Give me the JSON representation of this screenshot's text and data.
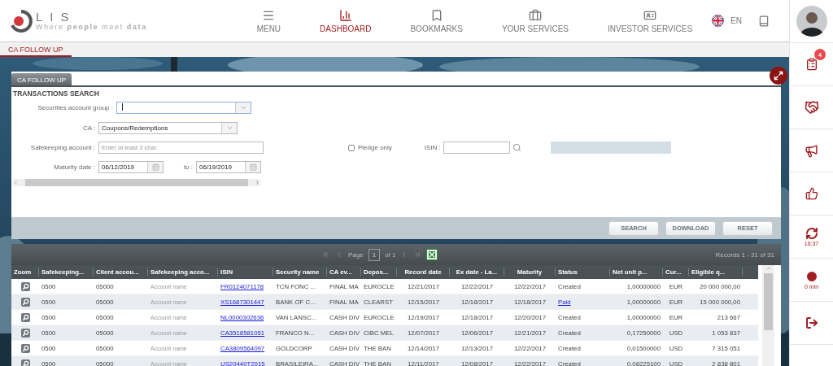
{
  "logo": {
    "name": "LIS",
    "tagline": "Where **people** meet **data**"
  },
  "nav": [
    {
      "label": "MENU",
      "selected": false
    },
    {
      "label": "DASHBOARD",
      "selected": true
    },
    {
      "label": "BOOKMARKS",
      "selected": false
    },
    {
      "label": "YOUR SERVICES",
      "selected": false
    },
    {
      "label": "INVESTOR SERVICES",
      "selected": false
    }
  ],
  "language": "EN",
  "subtabs": [
    {
      "label": "CA FOLLOW UP",
      "selected": true
    }
  ],
  "panel_tab": "CA FOLLOW UP",
  "search": {
    "title": "TRANSACTIONS SEARCH",
    "account_group": {
      "label": "Securities account group :"
    },
    "ca": {
      "label": "CA :",
      "value": "Coupons/Redemptions"
    },
    "safekeeping": {
      "label": "Safekeeping account :",
      "placeholder": "Enter at least 3 char."
    },
    "pledge": {
      "label": "Pledge only",
      "checked": false
    },
    "isin": {
      "label": "ISIN :"
    },
    "maturity": {
      "label": "Maturity date :",
      "from": "06/12/2019",
      "to_label": "to :",
      "to": "06/19/2019"
    }
  },
  "buttons": [
    "SEARCH",
    "DOWNLOAD",
    "RESET"
  ],
  "pager": {
    "page_label": "Page",
    "page": "1",
    "of": "of 1",
    "records": "Records 1 - 31 of 31"
  },
  "table": {
    "columns": [
      "Zoom",
      "Safekeeping...",
      "Client accou...",
      "Safekeeping acco...",
      "ISIN",
      "Security name",
      "CA ev...",
      "Depos...",
      "Record date",
      "Ex date - La...",
      "Maturity",
      "Status",
      "Net unit p...",
      "Cur...",
      "Eligible q..."
    ],
    "rows": [
      {
        "safekeeping": "0500",
        "client": "05000",
        "account": "Account name",
        "isin": "FR0124071178",
        "security": "TCN FONC ...",
        "ca_event": "FINAL MA",
        "depositary": "EUROCLE",
        "record_date": "12/21/2017",
        "ex_date": "12/22/2017",
        "maturity": "12/22/2017",
        "status": {
          "text": "Created",
          "kind": "text"
        },
        "net_unit": "1,00000000",
        "currency": "EUR",
        "eligible": "20 000 000,00"
      },
      {
        "safekeeping": "0500",
        "client": "05000",
        "account": "Account name",
        "isin": "XS1687301447",
        "security": "BANK OF C...",
        "ca_event": "FINAL MA",
        "depositary": "CLEARST",
        "record_date": "12/15/2017",
        "ex_date": "12/18/2017",
        "maturity": "12/18/2017",
        "status": {
          "text": "Paid",
          "kind": "link"
        },
        "net_unit": "1,00000000",
        "currency": "EUR",
        "eligible": "15 000 000,00"
      },
      {
        "safekeeping": "0500",
        "client": "05000",
        "account": "Account name",
        "isin": "NL0000302636",
        "security": "VAN LANSC...",
        "ca_event": "CASH DIV",
        "depositary": "EUROCLE",
        "record_date": "12/19/2017",
        "ex_date": "12/18/2017",
        "maturity": "12/20/2017",
        "status": {
          "text": "Created",
          "kind": "text"
        },
        "net_unit": "1,00000000",
        "currency": "EUR",
        "eligible": "213 667"
      },
      {
        "safekeeping": "0500",
        "client": "05000",
        "account": "Account name",
        "isin": "CA3518581051",
        "security": "FRANCO N...",
        "ca_event": "CASH DIV",
        "depositary": "CIBC MEL",
        "record_date": "12/07/2017",
        "ex_date": "12/06/2017",
        "maturity": "12/21/2017",
        "status": {
          "text": "Created",
          "kind": "text"
        },
        "net_unit": "0,17250000",
        "currency": "USD",
        "eligible": "1 053 837"
      },
      {
        "safekeeping": "0500",
        "client": "05000",
        "account": "Account name",
        "isin": "CA3809564097",
        "security": "GOLDCORP",
        "ca_event": "CASH DIV",
        "depositary": "THE BAN",
        "record_date": "12/14/2017",
        "ex_date": "12/13/2017",
        "maturity": "12/22/2017",
        "status": {
          "text": "Created",
          "kind": "text"
        },
        "net_unit": "0,01500000",
        "currency": "USD",
        "eligible": "7 315 051"
      },
      {
        "safekeeping": "0500",
        "client": "05000",
        "account": "Account name",
        "isin": "US20440T2015",
        "security": "BRASILEIRA...",
        "ca_event": "CASH DIV",
        "depositary": "THE BAN",
        "record_date": "12/11/2017",
        "ex_date": "12/08/2017",
        "maturity": "12/22/2017",
        "status": {
          "text": "Created",
          "kind": "text"
        },
        "net_unit": "0,08225100",
        "currency": "USD",
        "eligible": "2 838 801"
      }
    ]
  },
  "sidebar": {
    "badge": "4",
    "refresh_time": "16:37",
    "timer": "0 min"
  }
}
